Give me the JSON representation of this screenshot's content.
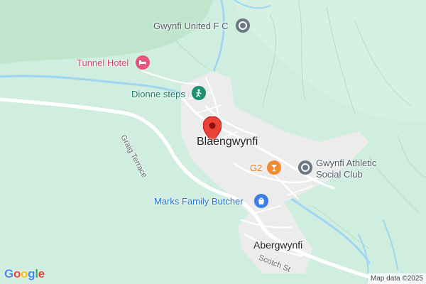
{
  "map": {
    "places": {
      "main": "Blaengwynfi",
      "secondary": "Abergwynfi"
    },
    "roads": {
      "graig_terrace": "Graig Terrace",
      "scotch_st": "Scotch St"
    },
    "pois": {
      "football_club": "Gwynfi United F C",
      "hotel": "Tunnel Hotel",
      "steps": "Dionne steps",
      "bar": "G2",
      "social_club_line1": "Gwynfi Athletic",
      "social_club_line2": "Social Club",
      "butcher": "Marks Family Butcher"
    },
    "logo": {
      "letters": [
        "G",
        "o",
        "o",
        "g",
        "l",
        "e"
      ],
      "colors": [
        "#4285F4",
        "#EA4335",
        "#FBBC05",
        "#4285F4",
        "#34A853",
        "#EA4335"
      ]
    },
    "attribution": "Map data ©2025",
    "colors": {
      "land": "#cfeee0",
      "forest": "#bfe6cd",
      "built_up": "#efefef",
      "water": "#9fd5f0",
      "road": "#ffffff",
      "marker": "#ea4335"
    },
    "icons": {
      "football_club": "generic-poi-icon",
      "hotel": "bed-icon",
      "steps": "hiker-icon",
      "bar": "cocktail-icon",
      "social_club": "generic-poi-icon",
      "butcher": "shopping-bag-icon",
      "marker": "location-pin-icon"
    }
  }
}
